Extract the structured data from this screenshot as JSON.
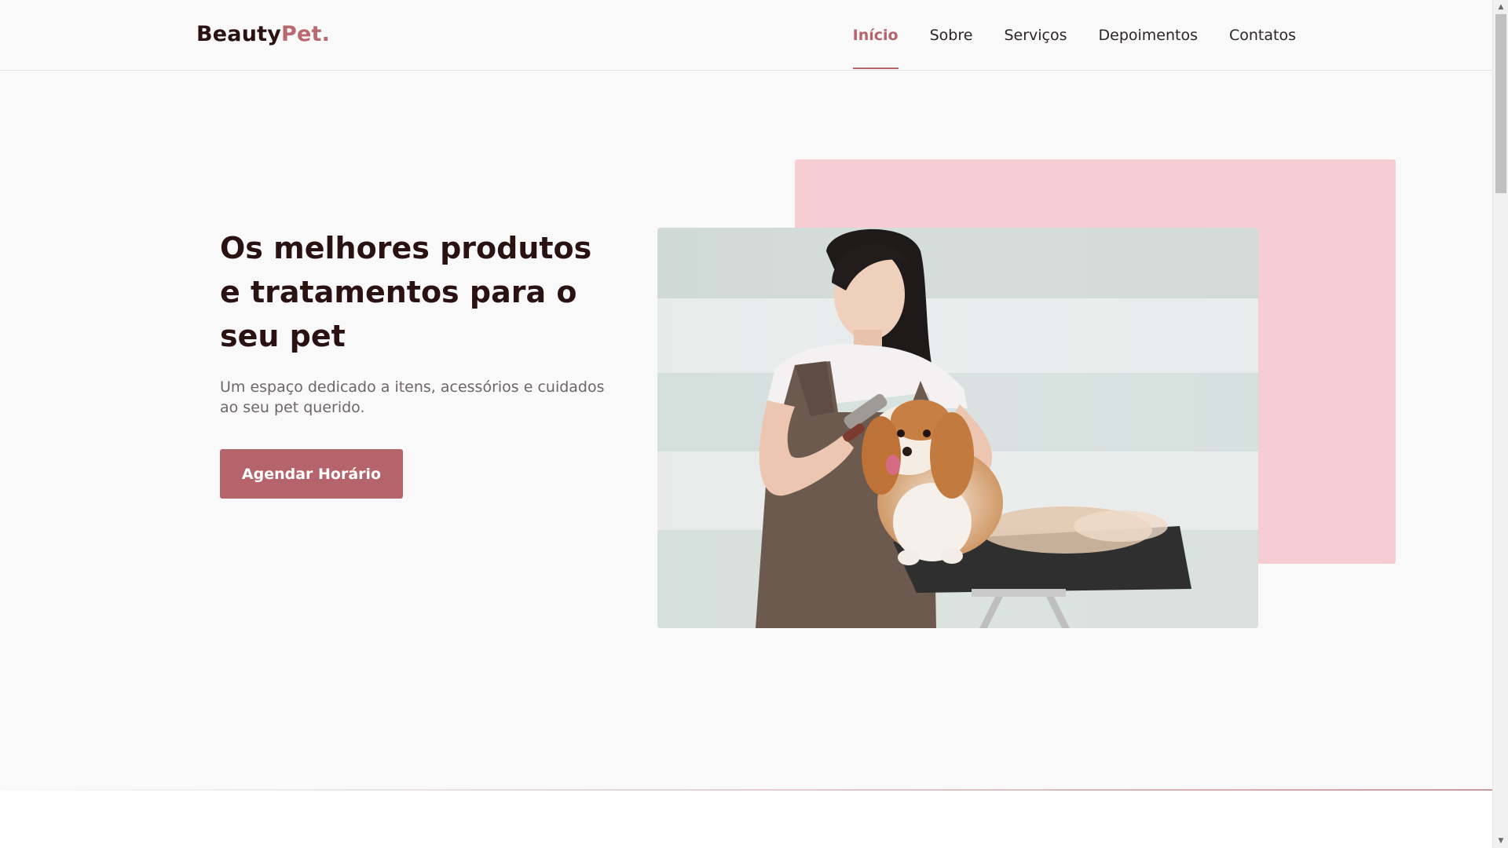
{
  "brand": {
    "name_main": "Beauty",
    "name_accent": "Pet."
  },
  "nav": {
    "items": [
      {
        "label": "Início",
        "active": true
      },
      {
        "label": "Sobre",
        "active": false
      },
      {
        "label": "Serviços",
        "active": false
      },
      {
        "label": "Depoimentos",
        "active": false
      },
      {
        "label": "Contatos",
        "active": false
      }
    ]
  },
  "hero": {
    "title": "Os melhores produtos e tratamentos para o seu pet",
    "subtitle": "Um espaço dedicado a itens, acessórios e cuidados ao seu pet querido.",
    "cta_label": "Agendar Horário",
    "image_alt": "Woman grooming a cavalier king charles spaniel on a grooming table"
  },
  "colors": {
    "accent": "#b5646b",
    "dark_text": "#2a1213",
    "pink_block": "#f5cdd2",
    "background": "#f9f9f9"
  },
  "icons": {
    "scroll_up": "scroll-up-arrow-icon",
    "scroll_down": "scroll-down-arrow-icon"
  }
}
